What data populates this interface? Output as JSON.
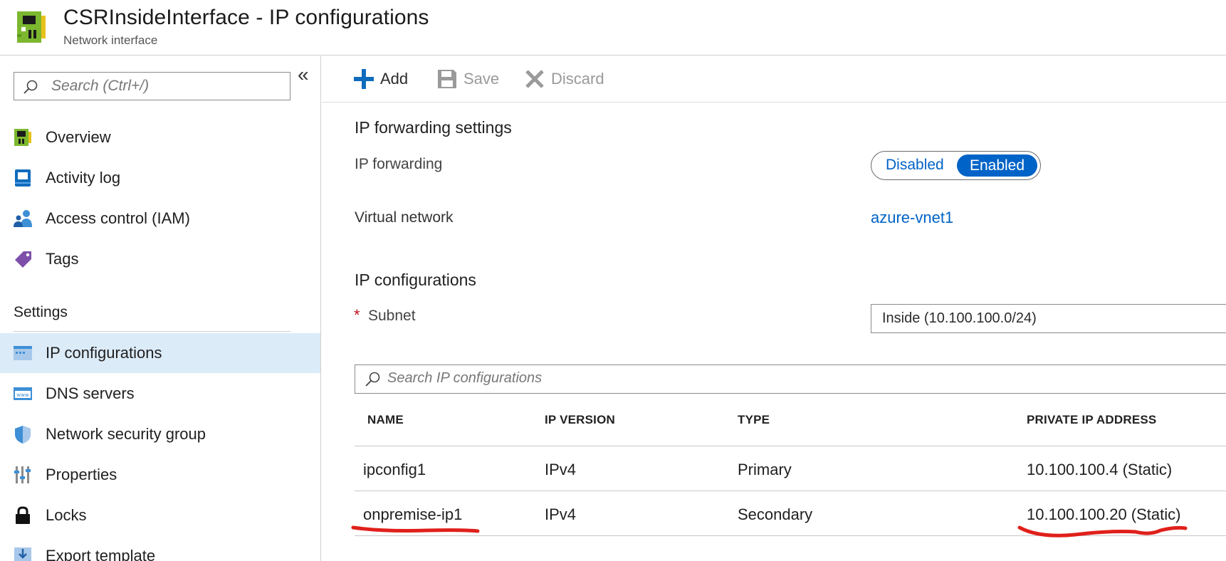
{
  "header": {
    "title": "CSRInsideInterface - IP configurations",
    "subtitle": "Network interface",
    "icon": "network-interface-icon"
  },
  "sidebar": {
    "search_placeholder": "Search (Ctrl+/)",
    "collapse_glyph": "«",
    "items": [
      {
        "label": "Overview",
        "icon": "overview-icon"
      },
      {
        "label": "Activity log",
        "icon": "activity-log-icon"
      },
      {
        "label": "Access control (IAM)",
        "icon": "access-control-icon"
      },
      {
        "label": "Tags",
        "icon": "tag-icon"
      }
    ],
    "settings_heading": "Settings",
    "settings_items": [
      {
        "label": "IP configurations",
        "icon": "ip-configurations-icon",
        "selected": true
      },
      {
        "label": "DNS servers",
        "icon": "dns-servers-icon"
      },
      {
        "label": "Network security group",
        "icon": "network-security-group-icon"
      },
      {
        "label": "Properties",
        "icon": "properties-icon"
      },
      {
        "label": "Locks",
        "icon": "lock-icon"
      },
      {
        "label": "Export template",
        "icon": "export-template-icon"
      }
    ]
  },
  "toolbar": {
    "add_label": "Add",
    "save_label": "Save",
    "discard_label": "Discard"
  },
  "forwarding": {
    "heading": "IP forwarding settings",
    "ip_forwarding_label": "IP forwarding",
    "toggle_off": "Disabled",
    "toggle_on": "Enabled",
    "toggle_value": "Enabled",
    "virtual_network_label": "Virtual network",
    "virtual_network_value": "azure-vnet1"
  },
  "ipconfig": {
    "heading": "IP configurations",
    "required_marker": "*",
    "subnet_label": "Subnet",
    "subnet_value": "Inside (10.100.100.0/24)",
    "search_placeholder": "Search IP configurations",
    "columns": [
      "NAME",
      "IP VERSION",
      "TYPE",
      "PRIVATE IP ADDRESS"
    ],
    "rows": [
      {
        "name": "ipconfig1",
        "version": "IPv4",
        "type": "Primary",
        "ip": "10.100.100.4 (Static)"
      },
      {
        "name": "onpremise-ip1",
        "version": "IPv4",
        "type": "Secondary",
        "ip": "10.100.100.20 (Static)"
      }
    ]
  },
  "colors": {
    "accent": "#0063c7",
    "selected_bg": "#dcebf8",
    "annotation": "#e0201b"
  }
}
